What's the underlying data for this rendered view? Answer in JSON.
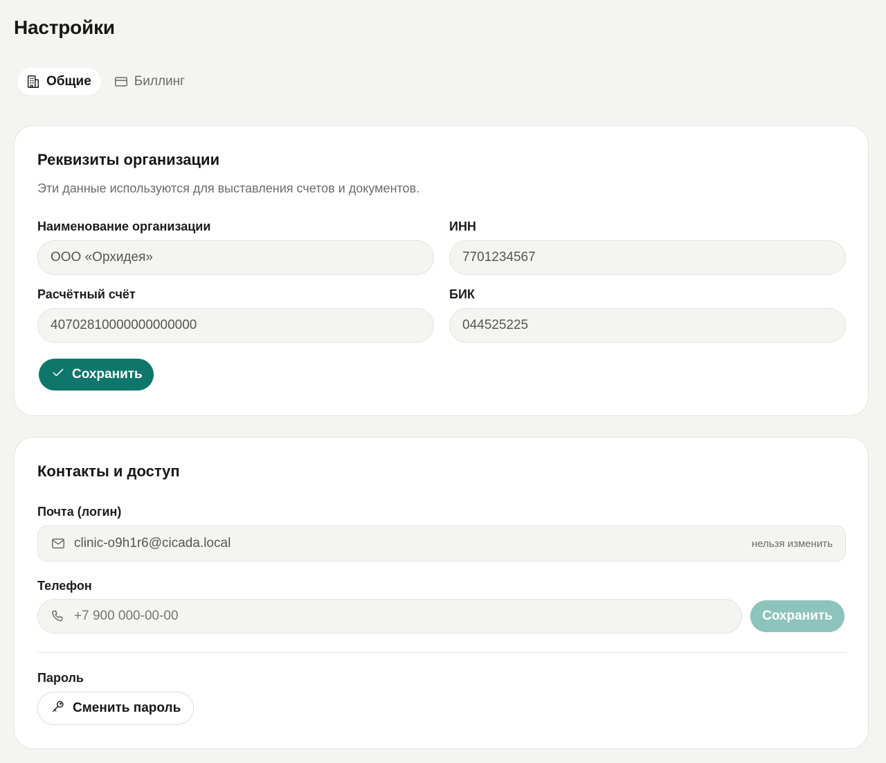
{
  "page": {
    "title": "Настройки"
  },
  "tabs": [
    {
      "label": "Общие",
      "icon": "building-icon",
      "active": true
    },
    {
      "label": "Биллинг",
      "icon": "credit-card-icon",
      "active": false
    }
  ],
  "org_details": {
    "title": "Реквизиты организации",
    "subtitle": "Эти данные используются для выставления счетов и документов.",
    "fields": {
      "org_name": {
        "label": "Наименование организации",
        "value": "ООО «Орхидея»"
      },
      "inn": {
        "label": "ИНН",
        "value": "7701234567"
      },
      "account": {
        "label": "Расчётный счёт",
        "value": "40702810000000000000"
      },
      "bik": {
        "label": "БИК",
        "value": "044525225"
      }
    },
    "save_label": "Сохранить"
  },
  "contacts": {
    "title": "Контакты и доступ",
    "email": {
      "label": "Почта (логин)",
      "value": "clinic-o9h1r6@cicada.local",
      "note": "нельзя изменить"
    },
    "phone": {
      "label": "Телефон",
      "placeholder": "+7 900 000-00-00",
      "save_label": "Сохранить"
    },
    "password": {
      "label": "Пароль",
      "change_label": "Сменить пароль"
    }
  },
  "colors": {
    "accent": "#0f766b",
    "accent_disabled": "#8cc3bb",
    "background": "#f4f4f2"
  }
}
